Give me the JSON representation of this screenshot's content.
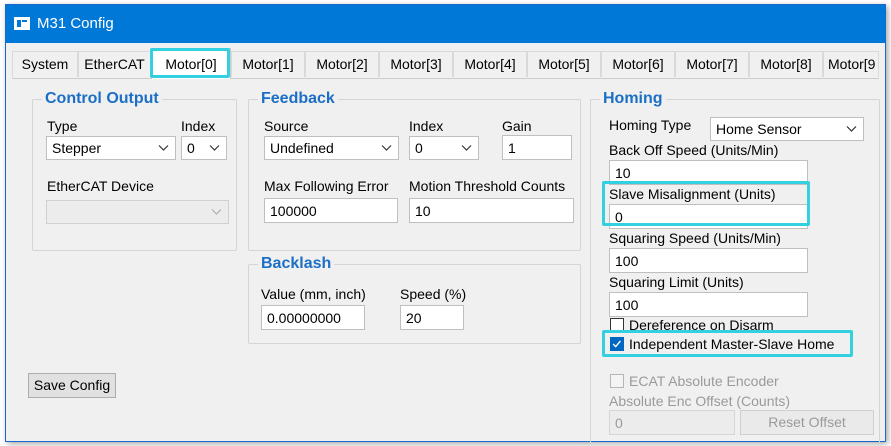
{
  "window": {
    "title": "M31 Config"
  },
  "tabs": [
    {
      "label": "System"
    },
    {
      "label": "EtherCAT"
    },
    {
      "label": "Motor[0]"
    },
    {
      "label": "Motor[1]"
    },
    {
      "label": "Motor[2]"
    },
    {
      "label": "Motor[3]"
    },
    {
      "label": "Motor[4]"
    },
    {
      "label": "Motor[5]"
    },
    {
      "label": "Motor[6]"
    },
    {
      "label": "Motor[7]"
    },
    {
      "label": "Motor[8]"
    },
    {
      "label": "Motor[9"
    }
  ],
  "control_output": {
    "title": "Control Output",
    "type_label": "Type",
    "type_value": "Stepper",
    "index_label": "Index",
    "index_value": "0",
    "device_label": "EtherCAT Device",
    "device_value": ""
  },
  "feedback": {
    "title": "Feedback",
    "source_label": "Source",
    "source_value": "Undefined",
    "index_label": "Index",
    "index_value": "0",
    "gain_label": "Gain",
    "gain_value": "1",
    "max_following_error_label": "Max Following Error",
    "max_following_error_value": "100000",
    "motion_threshold_label": "Motion Threshold Counts",
    "motion_threshold_value": "10"
  },
  "backlash": {
    "title": "Backlash",
    "value_label": "Value (mm, inch)",
    "value_value": "0.00000000",
    "speed_label": "Speed (%)",
    "speed_value": "20"
  },
  "homing": {
    "title": "Homing",
    "homing_type_label": "Homing Type",
    "homing_type_value": "Home Sensor",
    "back_off_speed_label": "Back Off Speed (Units/Min)",
    "back_off_speed_value": "10",
    "slave_misalignment_label": "Slave Misalignment (Units)",
    "slave_misalignment_value": "0",
    "squaring_speed_label": "Squaring Speed (Units/Min)",
    "squaring_speed_value": "100",
    "squaring_limit_label": "Squaring Limit (Units)",
    "squaring_limit_value": "100",
    "dereference_label": "Dereference on Disarm",
    "dereference_checked": false,
    "independent_home_label": "Independent Master-Slave Home",
    "independent_home_checked": true,
    "ecat_absolute_label": "ECAT Absolute Encoder",
    "ecat_absolute_checked": false,
    "abs_enc_offset_label": "Absolute Enc Offset (Counts)",
    "abs_enc_offset_value": "0",
    "reset_offset_label": "Reset Offset"
  },
  "save_config_label": "Save Config",
  "colors": {
    "titlebar": "#0078d7",
    "group_title": "#1c6fc5",
    "highlight": "#33d1e0",
    "checkbox_checked": "#0067c0"
  }
}
